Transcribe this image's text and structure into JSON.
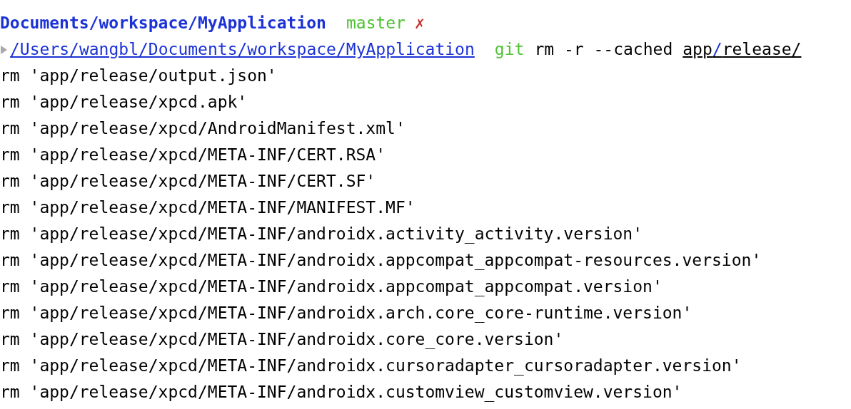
{
  "prompt": {
    "path": "Documents/workspace/MyApplication",
    "branch": "master",
    "dirty_mark": "✗"
  },
  "command_line": {
    "path_link": "/Users/wangbl/Documents/workspace/MyApplication",
    "command": "git",
    "options": "rm -r --cached",
    "argument": [
      {
        "text": "app",
        "kind": "plain"
      },
      {
        "text": "/",
        "kind": "separator"
      },
      {
        "text": "release/",
        "kind": "plain"
      }
    ]
  },
  "output_lines": [
    "rm 'app/release/output.json'",
    "rm 'app/release/xpcd.apk'",
    "rm 'app/release/xpcd/AndroidManifest.xml'",
    "rm 'app/release/xpcd/META-INF/CERT.RSA'",
    "rm 'app/release/xpcd/META-INF/CERT.SF'",
    "rm 'app/release/xpcd/META-INF/MANIFEST.MF'",
    "rm 'app/release/xpcd/META-INF/androidx.activity_activity.version'",
    "rm 'app/release/xpcd/META-INF/androidx.appcompat_appcompat-resources.version'",
    "rm 'app/release/xpcd/META-INF/androidx.appcompat_appcompat.version'",
    "rm 'app/release/xpcd/META-INF/androidx.arch.core_core-runtime.version'",
    "rm 'app/release/xpcd/META-INF/androidx.core_core.version'",
    "rm 'app/release/xpcd/META-INF/androidx.cursoradapter_cursoradapter.version'",
    "rm 'app/release/xpcd/META-INF/androidx.customview_customview.version'"
  ]
}
